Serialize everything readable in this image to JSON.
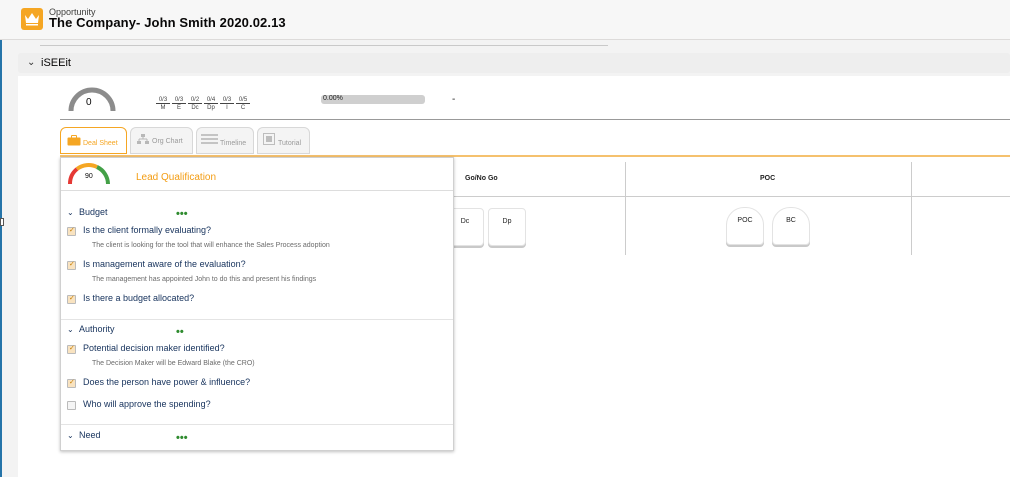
{
  "header": {
    "object_type": "Opportunity",
    "title": "The Company- John Smith 2020.02.13"
  },
  "section": {
    "label": "iSEEit"
  },
  "summary": {
    "gauge_value": "0",
    "scores": [
      {
        "frac": "0/3",
        "abbr": "M"
      },
      {
        "frac": "0/3",
        "abbr": "E"
      },
      {
        "frac": "0/2",
        "abbr": "Dc"
      },
      {
        "frac": "0/4",
        "abbr": "Dp"
      },
      {
        "frac": "0/3",
        "abbr": "I"
      },
      {
        "frac": "0/5",
        "abbr": "C"
      }
    ],
    "progress_text": "0.00%",
    "progress_value": 0,
    "dash": "-"
  },
  "tabs": [
    {
      "label": "Deal Sheet",
      "icon": "briefcase-icon",
      "active": true
    },
    {
      "label": "Org Chart",
      "icon": "org-chart-icon",
      "active": false
    },
    {
      "label": "Timeline",
      "icon": "timeline-icon",
      "active": false
    },
    {
      "label": "Tutorial",
      "icon": "tutorial-icon",
      "active": false
    }
  ],
  "columns": [
    {
      "title": "Go/No Go",
      "cards": [
        "Dc",
        "Dp"
      ]
    },
    {
      "title": "POC",
      "cards": [
        "POC",
        "BC"
      ]
    }
  ],
  "popup": {
    "score": "90",
    "title": "Lead Qualification",
    "groups": [
      {
        "name": "Budget",
        "questions": [
          {
            "text": "Is the client formally evaluating?",
            "checked": true,
            "note": "The client is looking for the tool that will enhance the Sales Process adoption"
          },
          {
            "text": "Is management aware of the evaluation?",
            "checked": true,
            "note": "The management has appointed John to do this and present his findings"
          },
          {
            "text": "Is there a budget allocated?",
            "checked": true,
            "note": ""
          }
        ]
      },
      {
        "name": "Authority",
        "questions": [
          {
            "text": "Potential decision maker identified?",
            "checked": true,
            "note": "The Decision Maker will be Edward Blake (the CRO)"
          },
          {
            "text": "Does the person have power & influence?",
            "checked": true,
            "note": ""
          },
          {
            "text": "Who will approve the spending?",
            "checked": false,
            "note": ""
          }
        ]
      },
      {
        "name": "Need",
        "questions": []
      }
    ]
  },
  "colors": {
    "accent": "#f5a623",
    "popup_title": "#f39c12",
    "text": "#16325c",
    "dots": "#2e8b2e"
  }
}
